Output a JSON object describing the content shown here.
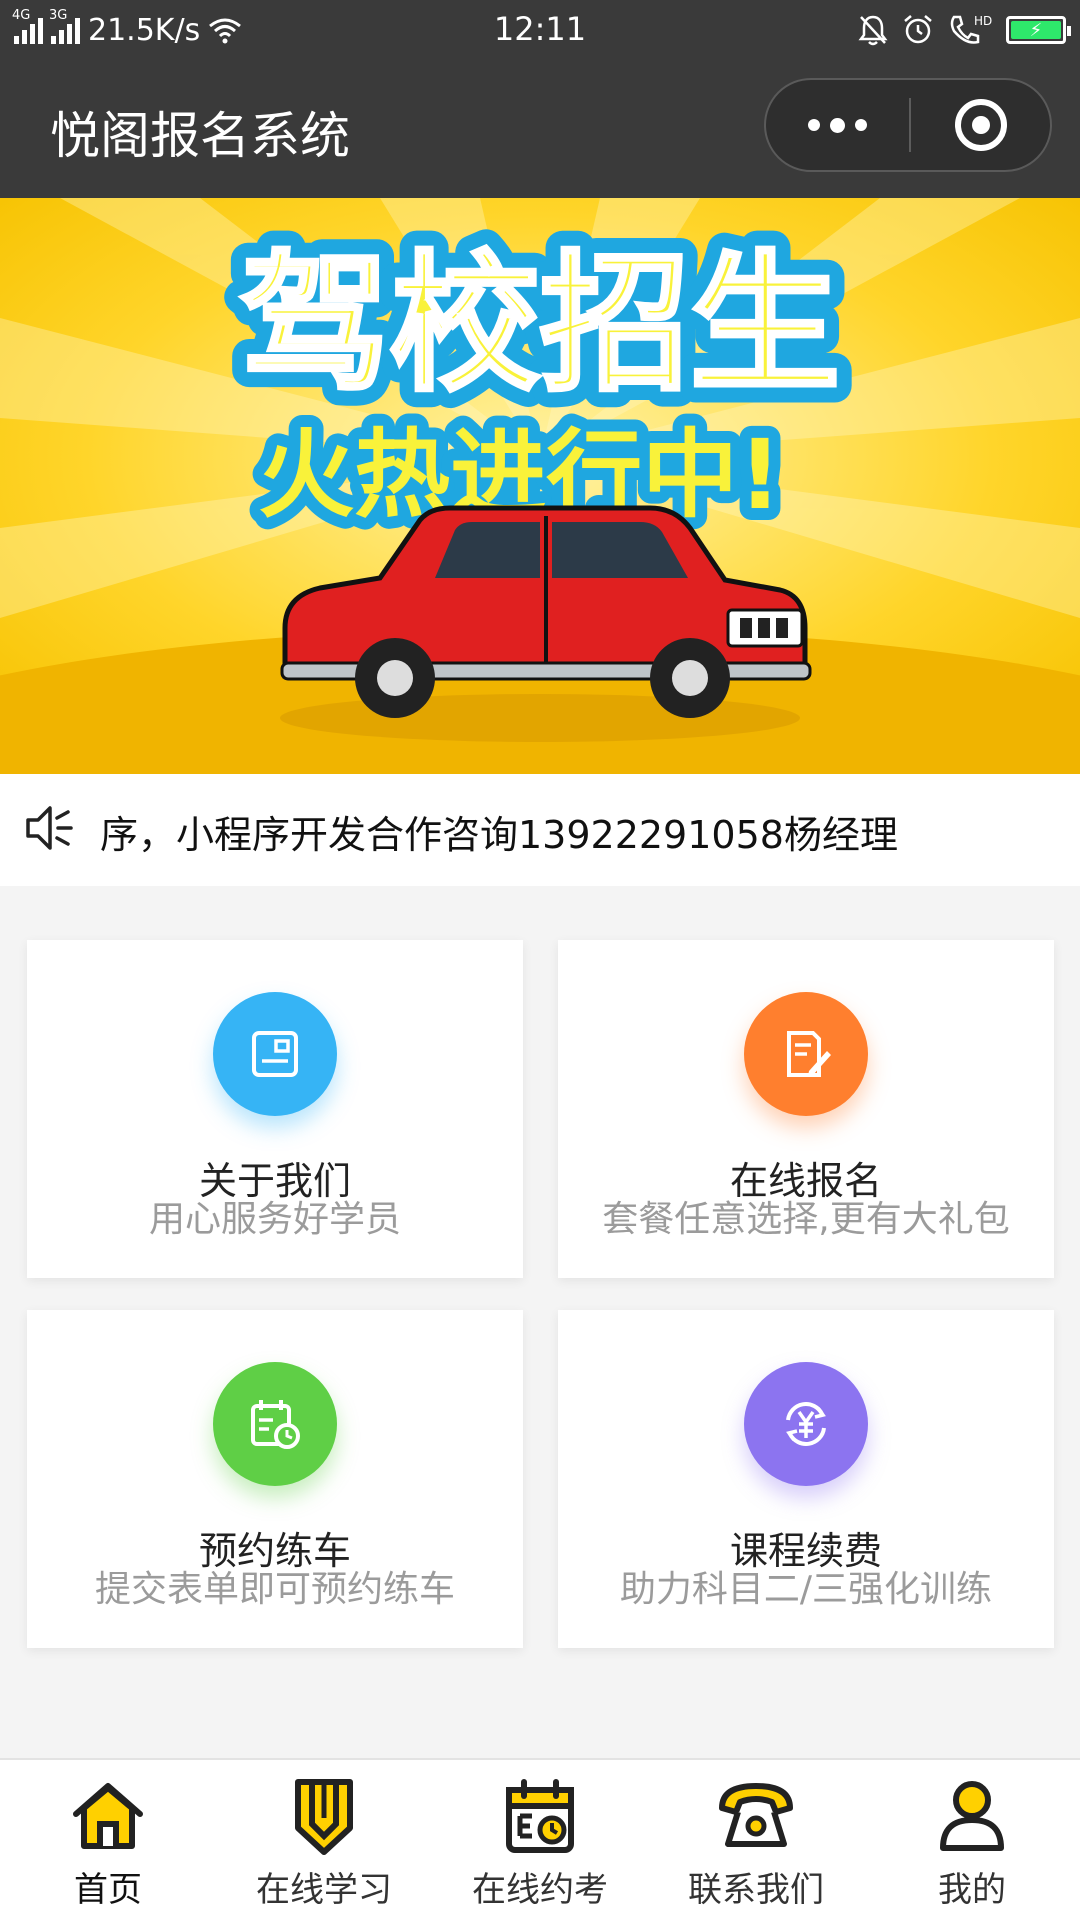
{
  "status_bar": {
    "network_1": "4G",
    "network_2": "3G",
    "speed": "21.5K/s",
    "time": "12:11",
    "hd_label": "HD",
    "icons": [
      "signal-icon",
      "wifi-icon",
      "mute-bell-icon",
      "alarm-icon",
      "hd-call-icon",
      "battery-icon"
    ],
    "battery_color": "#2ee86b"
  },
  "nav": {
    "title": "悦阁报名系统",
    "more_icon": "more-dots-icon",
    "close_icon": "close-target-icon"
  },
  "banner": {
    "headline": "驾校招生",
    "subline": "火热进行中!",
    "bg_color": "#ffd21f"
  },
  "notice": {
    "icon": "speaker-icon",
    "text": "序，小程序开发合作咨询13922291058杨经理"
  },
  "grid": [
    {
      "name": "关于我们",
      "desc": "用心服务好学员",
      "icon": "card-icon",
      "color": "#36b4f5"
    },
    {
      "name": "在线报名",
      "desc": "套餐任意选择,更有大礼包",
      "icon": "edit-form-icon",
      "color": "#ff7f2e"
    },
    {
      "name": "预约练车",
      "desc": "提交表单即可预约练车",
      "icon": "calendar-clock-icon",
      "color": "#5fcf46"
    },
    {
      "name": "课程续费",
      "desc": "助力科目二/三强化训练",
      "icon": "yen-refresh-icon",
      "color": "#8c74f0"
    }
  ],
  "tabs": [
    {
      "label": "首页",
      "icon": "home-icon",
      "active": true
    },
    {
      "label": "在线学习",
      "icon": "pencil-shield-icon",
      "active": false
    },
    {
      "label": "在线约考",
      "icon": "calendar-icon",
      "active": false
    },
    {
      "label": "联系我们",
      "icon": "telephone-icon",
      "active": false
    },
    {
      "label": "我的",
      "icon": "user-icon",
      "active": false
    }
  ],
  "colors": {
    "tab_icon_yellow": "#ffd000",
    "dark_bar": "#3a3a3a"
  }
}
